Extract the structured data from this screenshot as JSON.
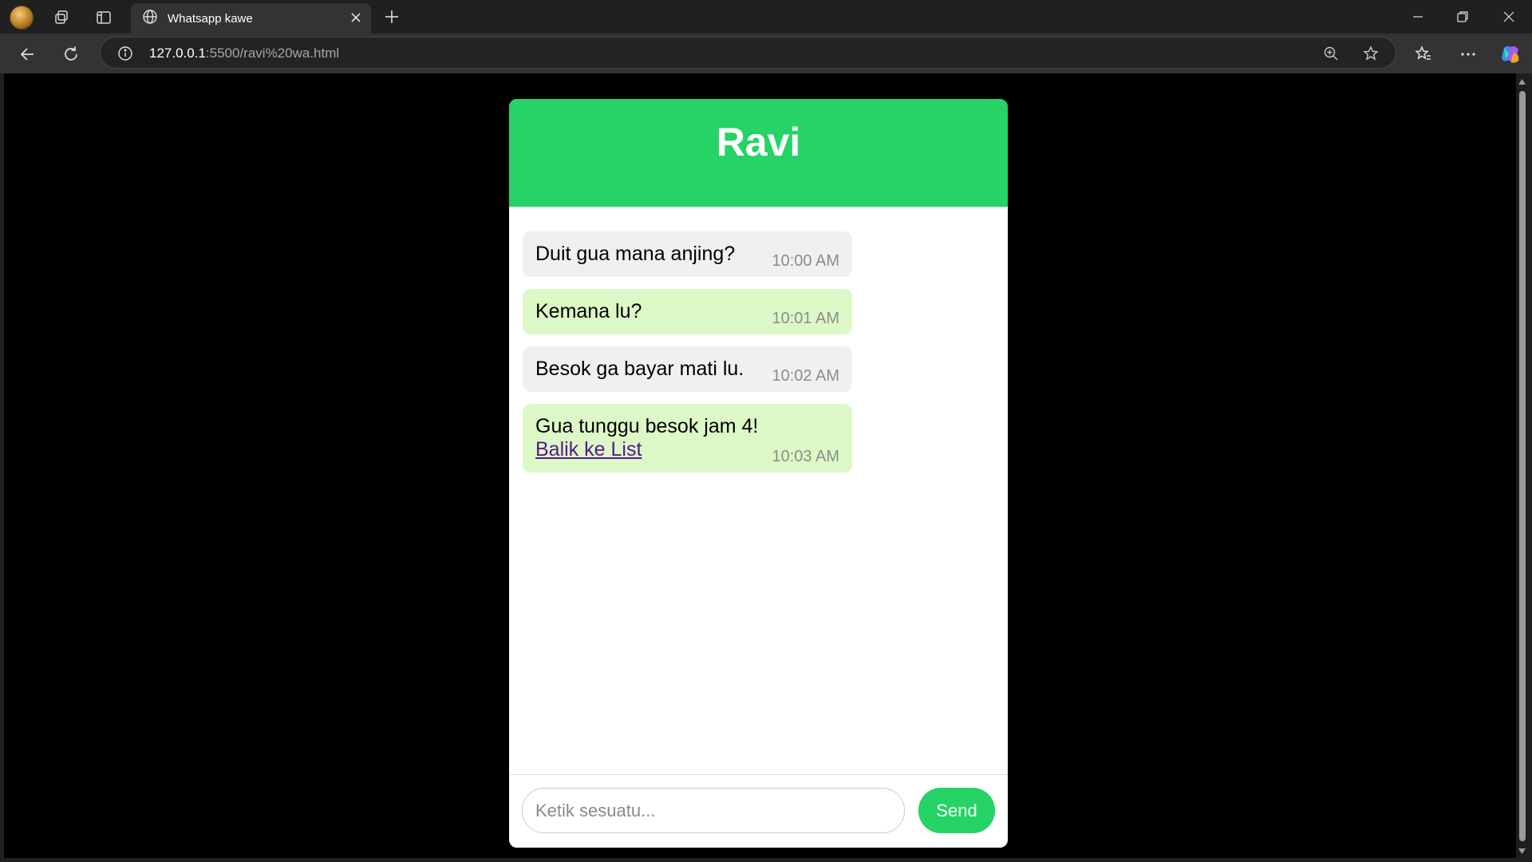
{
  "browser": {
    "tab_title": "Whatsapp kawe",
    "url_host": "127.0.0.1",
    "url_rest": ":5500/ravi%20wa.html"
  },
  "chat": {
    "title": "Ravi",
    "messages": [
      {
        "text": "Duit gua mana anjing?",
        "time": "10:00 AM",
        "direction": "in"
      },
      {
        "text": "Kemana lu?",
        "time": "10:01 AM",
        "direction": "out"
      },
      {
        "text": "Besok ga bayar mati lu.",
        "time": "10:02 AM",
        "direction": "in"
      },
      {
        "text": "Gua tunggu besok jam 4!",
        "link": "Balik ke List",
        "time": "10:03 AM",
        "direction": "out"
      }
    ],
    "input_placeholder": "Ketik sesuatu...",
    "send_label": "Send"
  },
  "colors": {
    "brand_green": "#25d366",
    "incoming_bubble": "#f0f0f0",
    "outgoing_bubble": "#dcf8c6"
  }
}
